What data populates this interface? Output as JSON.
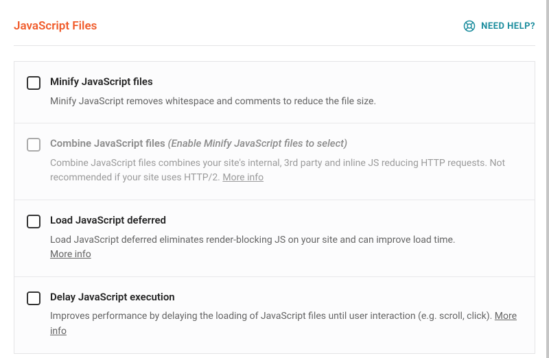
{
  "header": {
    "title": "JavaScript Files",
    "help_label": "NEED HELP?"
  },
  "options": [
    {
      "title": "Minify JavaScript files",
      "note": "",
      "desc": "Minify JavaScript removes whitespace and comments to reduce the file size.",
      "more": ""
    },
    {
      "title": "Combine JavaScript files",
      "note": "(Enable Minify JavaScript files to select)",
      "desc": "Combine JavaScript files combines your site's internal, 3rd party and inline JS reducing HTTP requests. Not recommended if your site uses HTTP/2. ",
      "more": "More info"
    },
    {
      "title": "Load JavaScript deferred",
      "note": "",
      "desc": "Load JavaScript deferred eliminates render-blocking JS on your site and can improve load time. ",
      "more": "More info"
    },
    {
      "title": "Delay JavaScript execution",
      "note": "",
      "desc": "Improves performance by delaying the loading of JavaScript files until user interaction (e.g. scroll, click). ",
      "more": "More info"
    }
  ]
}
